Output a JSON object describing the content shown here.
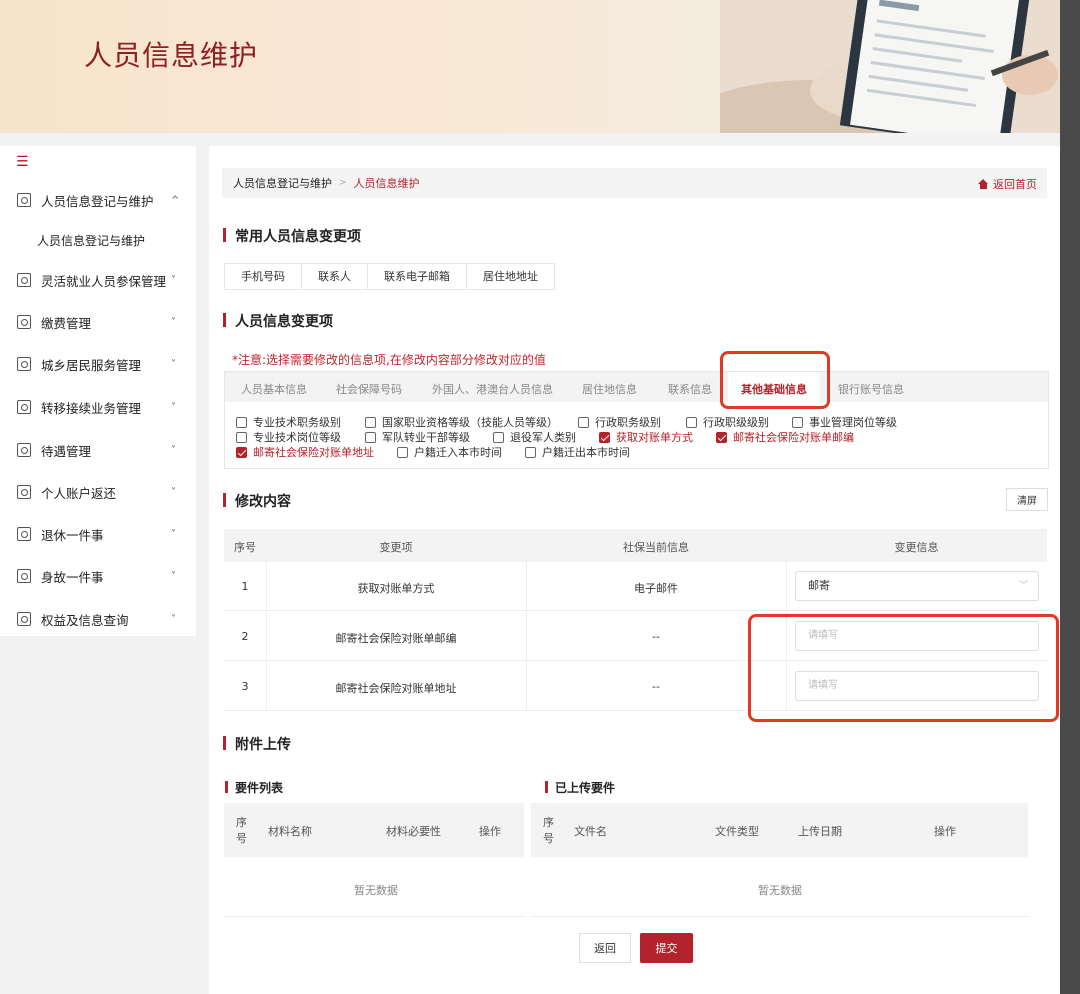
{
  "banner": {
    "title": "人员信息维护"
  },
  "sidebar": {
    "items": [
      {
        "label": "人员信息登记与维护",
        "chevron": "^"
      },
      {
        "label": "人员信息登记与维护",
        "sub": true
      },
      {
        "label": "灵活就业人员参保管理",
        "chevron": "˅"
      },
      {
        "label": "缴费管理",
        "chevron": "˅"
      },
      {
        "label": "城乡居民服务管理",
        "chevron": "˅"
      },
      {
        "label": "转移接续业务管理",
        "chevron": "˅"
      },
      {
        "label": "待遇管理",
        "chevron": "˅"
      },
      {
        "label": "个人账户返还",
        "chevron": "˅"
      },
      {
        "label": "退休一件事",
        "chevron": "˅"
      },
      {
        "label": "身故一件事",
        "chevron": "˅"
      },
      {
        "label": "权益及信息查询",
        "chevron": "˅"
      }
    ]
  },
  "breadcrumb": {
    "home": "人员信息登记与维护",
    "sep": ">",
    "current": "人员信息维护",
    "back": "返回首页"
  },
  "sections": {
    "common": "常用人员信息变更项",
    "change_items": "人员信息变更项",
    "modify": "修改内容",
    "attach": "附件上传"
  },
  "common_chips": [
    "手机号码",
    "联系人",
    "联系电子邮箱",
    "居住地地址"
  ],
  "notice": "*注意:选择需要修改的信息项,在修改内容部分修改对应的值",
  "tabs": [
    "人员基本信息",
    "社会保障号码",
    "外国人、港澳台人员信息",
    "居住地信息",
    "联系信息",
    "其他基础信息",
    "银行账号信息"
  ],
  "checkboxes": [
    {
      "label": "专业技术职务级别",
      "checked": false
    },
    {
      "label": "国家职业资格等级（技能人员等级）",
      "checked": false
    },
    {
      "label": "行政职务级别",
      "checked": false
    },
    {
      "label": "行政职级级别",
      "checked": false
    },
    {
      "label": "事业管理岗位等级",
      "checked": false
    },
    {
      "label": "专业技术岗位等级",
      "checked": false
    },
    {
      "label": "军队转业干部等级",
      "checked": false
    },
    {
      "label": "退役军人类别",
      "checked": false
    },
    {
      "label": "获取对账单方式",
      "checked": true
    },
    {
      "label": "邮寄社会保险对账单邮编",
      "checked": true
    },
    {
      "label": "邮寄社会保险对账单地址",
      "checked": true
    },
    {
      "label": "户籍迁入本市时间",
      "checked": false
    },
    {
      "label": "户籍迁出本市时间",
      "checked": false
    }
  ],
  "clear_label": "清屏",
  "table": {
    "headers": [
      "序号",
      "变更项",
      "社保当前信息",
      "变更信息"
    ],
    "rows": [
      {
        "no": "1",
        "item": "获取对账单方式",
        "current": "电子邮件",
        "value": "邮寄"
      },
      {
        "no": "2",
        "item": "邮寄社会保险对账单邮编",
        "current": "--",
        "placeholder": "请填写"
      },
      {
        "no": "3",
        "item": "邮寄社会保险对账单地址",
        "current": "--",
        "placeholder": "请填写"
      }
    ]
  },
  "upload": {
    "req_title": "要件列表",
    "req_headers": [
      "序号",
      "材料名称",
      "材料必要性",
      "操作"
    ],
    "done_title": "已上传要件",
    "done_headers": [
      "序号",
      "文件名",
      "文件类型",
      "上传日期",
      "操作"
    ],
    "empty": "暂无数据"
  },
  "buttons": {
    "back": "返回",
    "submit": "提交"
  },
  "colors": {
    "brand": "#b4222b",
    "highlight": "#e13a22"
  }
}
